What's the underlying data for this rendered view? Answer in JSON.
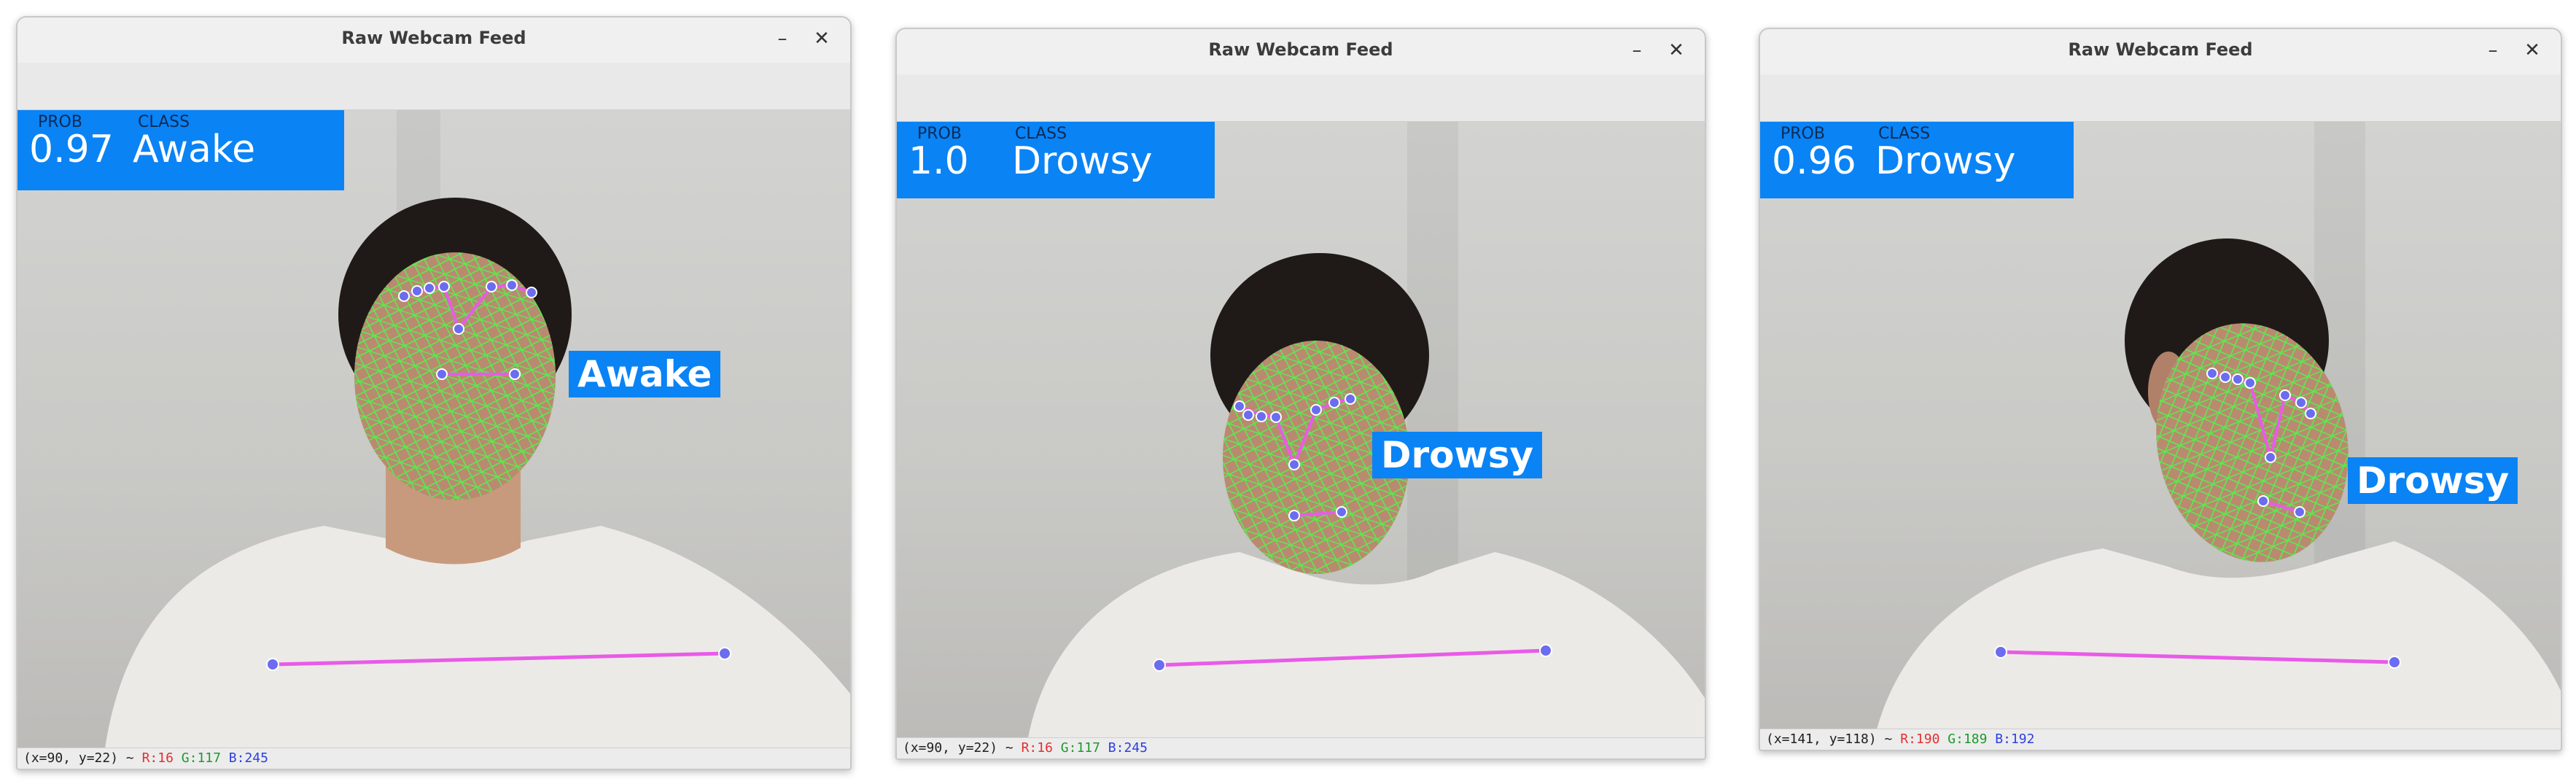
{
  "windows": [
    {
      "title": "Raw Webcam Feed",
      "minimize_icon": "minimize-icon",
      "close_icon": "close-icon",
      "prob_label": "PROB",
      "class_label": "CLASS",
      "prob_value": "0.97",
      "class_value": "Awake",
      "face_label": "Awake",
      "status": {
        "coords": "(x=90, y=22) ~",
        "r": "R:16",
        "g": "G:117",
        "b": "B:245"
      }
    },
    {
      "title": "Raw Webcam Feed",
      "minimize_icon": "minimize-icon",
      "close_icon": "close-icon",
      "prob_label": "PROB",
      "class_label": "CLASS",
      "prob_value": "1.0",
      "class_value": "Drowsy",
      "face_label": "Drowsy",
      "status": {
        "coords": "(x=90, y=22) ~",
        "r": "R:16",
        "g": "G:117",
        "b": "B:245"
      }
    },
    {
      "title": "Raw Webcam Feed",
      "minimize_icon": "minimize-icon",
      "close_icon": "close-icon",
      "prob_label": "PROB",
      "class_label": "CLASS",
      "prob_value": "0.96",
      "class_value": "Drowsy",
      "face_label": "Drowsy",
      "status": {
        "coords": "(x=141, y=118) ~",
        "r": "R:190",
        "g": "G:189",
        "b": "B:192"
      }
    }
  ],
  "colors": {
    "label_blue": "#0A83F5",
    "mesh_green": "#5BEA4F",
    "landmark_magenta": "#E85BE8",
    "landmark_point": "#6C6CF0"
  }
}
